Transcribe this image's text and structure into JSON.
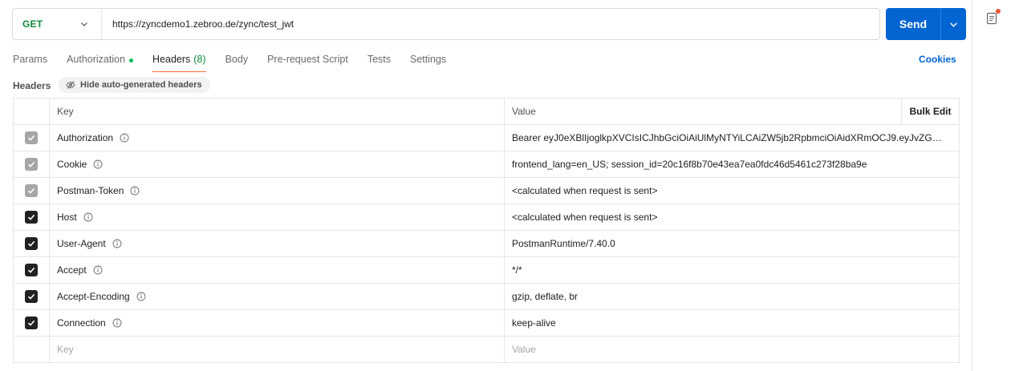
{
  "request": {
    "method": "GET",
    "url": "https://zyncdemo1.zebroo.de/zync/test_jwt",
    "send_label": "Send"
  },
  "tabs": [
    {
      "label": "Params"
    },
    {
      "label": "Authorization"
    },
    {
      "label": "Headers",
      "count": "(8)"
    },
    {
      "label": "Body"
    },
    {
      "label": "Pre-request Script"
    },
    {
      "label": "Tests"
    },
    {
      "label": "Settings"
    }
  ],
  "cookies_label": "Cookies",
  "headers_section": {
    "title": "Headers",
    "hide_button": "Hide auto-generated headers"
  },
  "table": {
    "col_key": "Key",
    "col_value": "Value",
    "bulk_edit": "Bulk Edit",
    "rows": [
      {
        "key": "Authorization",
        "value": "Bearer eyJ0eXBlIjoglkpXVCIsICJhbGciOiAiUlMyNTYiLCAiZW5jb2RpbmciOiAidXRmOCJ9.eyJvZG…",
        "checked": "disabled"
      },
      {
        "key": "Cookie",
        "value": "frontend_lang=en_US; session_id=20c16f8b70e43ea7ea0fdc46d5461c273f28ba9e",
        "checked": "disabled"
      },
      {
        "key": "Postman-Token",
        "value": "<calculated when request is sent>",
        "checked": "disabled"
      },
      {
        "key": "Host",
        "value": "<calculated when request is sent>",
        "checked": "on"
      },
      {
        "key": "User-Agent",
        "value": "PostmanRuntime/7.40.0",
        "checked": "on"
      },
      {
        "key": "Accept",
        "value": "*/*",
        "checked": "on"
      },
      {
        "key": "Accept-Encoding",
        "value": "gzip, deflate, br",
        "checked": "on"
      },
      {
        "key": "Connection",
        "value": "keep-alive",
        "checked": "on"
      }
    ],
    "new_row": {
      "key_placeholder": "Key",
      "value_placeholder": "Value"
    }
  },
  "colors": {
    "accent": "#0265d2",
    "method_get": "#0f8a3a",
    "active_tab_underline": "#ff6c37",
    "auth_dot": "#0cbb52",
    "notification_dot": "#eb5334"
  },
  "icons": {
    "method_dropdown": "chevron-down-icon",
    "send_dropdown": "chevron-down-icon",
    "hide_headers": "eye-off-icon",
    "row_info": "info-icon",
    "sidebar": "documentation-icon"
  }
}
